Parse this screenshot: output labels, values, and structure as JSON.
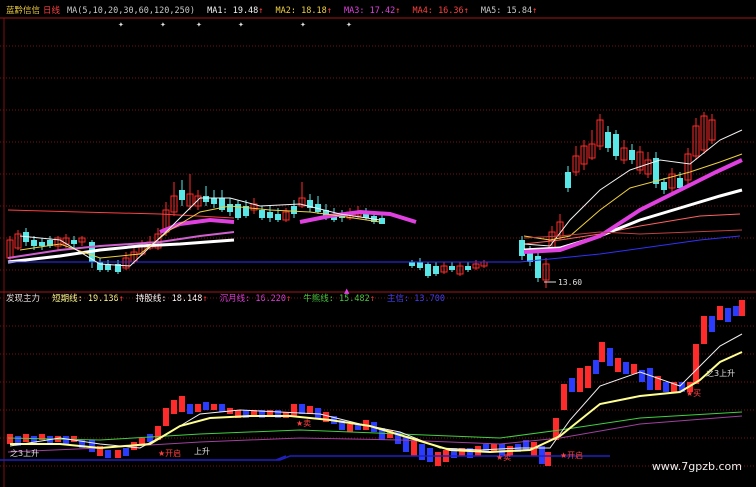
{
  "colors": {
    "bg": "#000000",
    "grid": "#7a1010",
    "up": "#ff2a2a",
    "down": "#58e6e6",
    "down2": "#2a3cff",
    "ma1": "#f2f2f2",
    "ma2": "#f0d040",
    "ma3": "#e040e0",
    "ma4": "#ff4040",
    "ma5": "#c8c8c8",
    "line_short": "#ffff90",
    "line_hold": "#ffffff",
    "line_month": "#e040e0",
    "line_bull": "#40d040",
    "line_sig": "#4040ff"
  },
  "top_panel": {
    "stock_name": "蓝黔信信",
    "period": "日线",
    "ma_params": "MA(5,10,20,30,60,120,250)",
    "ma1": {
      "label": "MA1:",
      "value": "19.48",
      "arrow": "↑"
    },
    "ma2": {
      "label": "MA2:",
      "value": "18.18",
      "arrow": "↑"
    },
    "ma3": {
      "label": "MA3:",
      "value": "17.42",
      "arrow": "↑"
    },
    "ma4": {
      "label": "MA4:",
      "value": "16.36",
      "arrow": "↑"
    },
    "ma5": {
      "label": "MA5:",
      "value": "15.84",
      "arrow": "↑"
    },
    "low_label": "13.60"
  },
  "bottom_panel": {
    "title": "发现主力",
    "short": {
      "label": "短期线:",
      "value": "19.136",
      "arrow": "↑"
    },
    "hold": {
      "label": "持股线:",
      "value": "18.148",
      "arrow": "↑"
    },
    "month": {
      "label": "沉月线:",
      "value": "16.220",
      "arrow": "↑"
    },
    "bull": {
      "label": "牛熊线:",
      "value": "15.482",
      "arrow": "↑"
    },
    "signal": {
      "label": "主信:",
      "value": "13.700"
    },
    "annotations": [
      "之3上升",
      "★开启",
      "★卖",
      "上升",
      "★卖",
      "★开启",
      "之3上升",
      "★买"
    ]
  },
  "watermark": "www.7gpzb.com"
}
